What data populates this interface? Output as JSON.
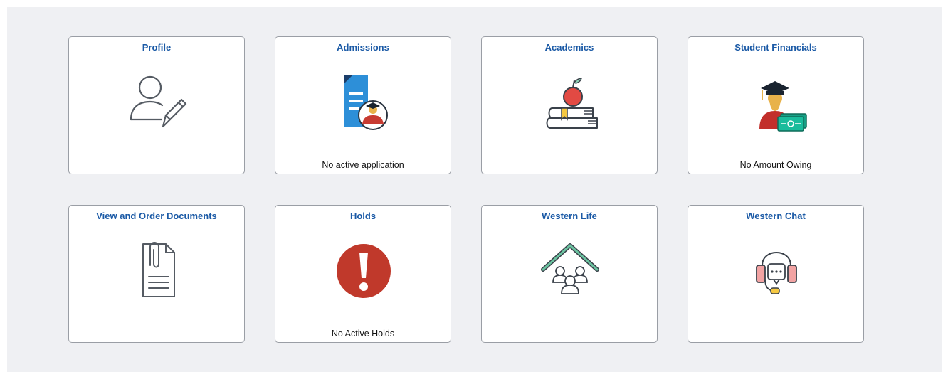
{
  "tiles": [
    {
      "title": "Profile",
      "icon": "profile-edit-icon",
      "status": ""
    },
    {
      "title": "Admissions",
      "icon": "admissions-document-icon",
      "status": "No active application"
    },
    {
      "title": "Academics",
      "icon": "books-apple-icon",
      "status": ""
    },
    {
      "title": "Student Financials",
      "icon": "graduate-money-icon",
      "status": "No Amount Owing"
    },
    {
      "title": "View and Order Documents",
      "icon": "clipped-document-icon",
      "status": ""
    },
    {
      "title": "Holds",
      "icon": "exclamation-alert-icon",
      "status": "No Active Holds"
    },
    {
      "title": "Western Life",
      "icon": "house-people-icon",
      "status": ""
    },
    {
      "title": "Western Chat",
      "icon": "headset-chat-icon",
      "status": ""
    }
  ],
  "colors": {
    "title": "#1b5aa6",
    "background": "#eff0f3",
    "border": "#9a9ea5",
    "holds_red": "#c0392b"
  }
}
